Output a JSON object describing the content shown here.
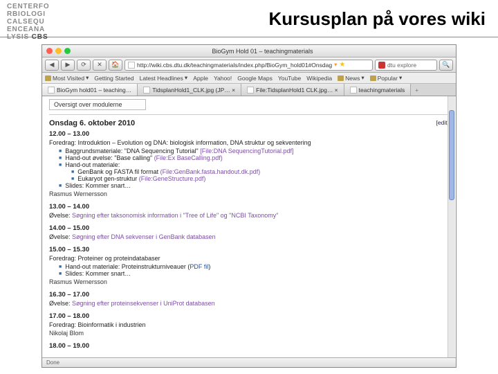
{
  "header": {
    "logo_lines": [
      "CENTERFO",
      "RBIOLOGI",
      "CALSEQU",
      "ENCEANA",
      "LYSIS"
    ],
    "logo_cbs": "CBS",
    "slide_title": "Kursusplan på vores wiki"
  },
  "window": {
    "title": "BioGym Hold 01 – teachingmaterials"
  },
  "urlbar": {
    "back": "◀",
    "forward": "▶",
    "reload": "⟳",
    "stop": "✕",
    "home": "🏠",
    "url": "http://wiki.cbs.dtu.dk/teachingmaterials/index.php/BioGym_hold01#Onsdag",
    "rss": "▾",
    "search_provider": "dtu explore",
    "search_mag": "🔍"
  },
  "bookmarks": {
    "items": [
      {
        "label": "Most Visited",
        "folder": true,
        "drop": "▾"
      },
      {
        "label": "Getting Started"
      },
      {
        "label": "Latest Headlines",
        "drop": "▾"
      },
      {
        "label": "Apple"
      },
      {
        "label": "Yahoo!"
      },
      {
        "label": "Google Maps"
      },
      {
        "label": "YouTube"
      },
      {
        "label": "Wikipedia"
      },
      {
        "label": "News",
        "folder": true,
        "drop": "▾"
      },
      {
        "label": "Popular",
        "folder": true,
        "drop": "▾"
      }
    ]
  },
  "tabs": [
    {
      "label": "BioGym hold01 – teaching…",
      "active": true
    },
    {
      "label": "TidsplanHold1_CLK.jpg (JP… ×"
    },
    {
      "label": "File:TidsplanHold1 CLK.jpg… ×"
    },
    {
      "label": "teachingmaterials"
    }
  ],
  "tab_plus": "+",
  "content": {
    "overview": "Oversigt over modulerne",
    "date": "Onsdag 6. oktober 2010",
    "edit": "[edit]",
    "sessions": [
      {
        "time": "12.00 – 13.00",
        "desc": "Foredrag: Introduktion – Evolution og DNA: biologisk information, DNA struktur og sekventering",
        "bullets": [
          {
            "text": "Baggrundsmateriale: \"DNA Sequencing Tutorial\" ",
            "link": "[File:DNA SequencingTutorial.pdf]"
          },
          {
            "text": "Hand-out øvelse: \"Base calling\" ",
            "link": "(File:Ex BaseCalling.pdf)"
          },
          {
            "text": "Hand-out materiale:",
            "sub": [
              {
                "text": "GenBank og FASTA fil format ",
                "link": "(File:GenBank.fasta.handout.dk.pdf)"
              },
              {
                "text": "Eukaryot gen-struktur ",
                "link": "(File:GeneStructure.pdf)"
              }
            ]
          },
          {
            "text": "Slides: Kommer snart…"
          }
        ],
        "presenter": "Rasmus Wernersson"
      },
      {
        "time": "13.00 – 14.00",
        "desc_pre": "Øvelse: ",
        "desc_link": "Søgning efter taksonomisk information i \"Tree of Life\" og \"NCBI Taxonomy\""
      },
      {
        "time": "14.00 – 15.00",
        "desc_pre": "Øvelse: ",
        "desc_link": "Søgning efter DNA sekvenser i GenBank databasen"
      },
      {
        "time": "15.00 – 15.30",
        "desc": "Foredrag: Proteiner og proteindatabaser",
        "bullets": [
          {
            "text": "Hand-out materiale: Proteinstrukturniveauer (",
            "link": "PDF fil",
            "suf": ")"
          },
          {
            "text": "Slides: Kommer snart…"
          }
        ],
        "presenter": "Rasmus Wernersson"
      },
      {
        "time": "16.30 – 17.00",
        "desc_pre": "Øvelse: ",
        "desc_link": "Søgning efter proteinsekvenser i UniProt databasen"
      },
      {
        "time": "17.00 – 18.00",
        "desc": "Foredrag: Bioinformatik i industrien",
        "presenter": "Nikolaj Blom"
      },
      {
        "time": "18.00 – 19.00"
      }
    ]
  },
  "status": {
    "left": "Done"
  }
}
